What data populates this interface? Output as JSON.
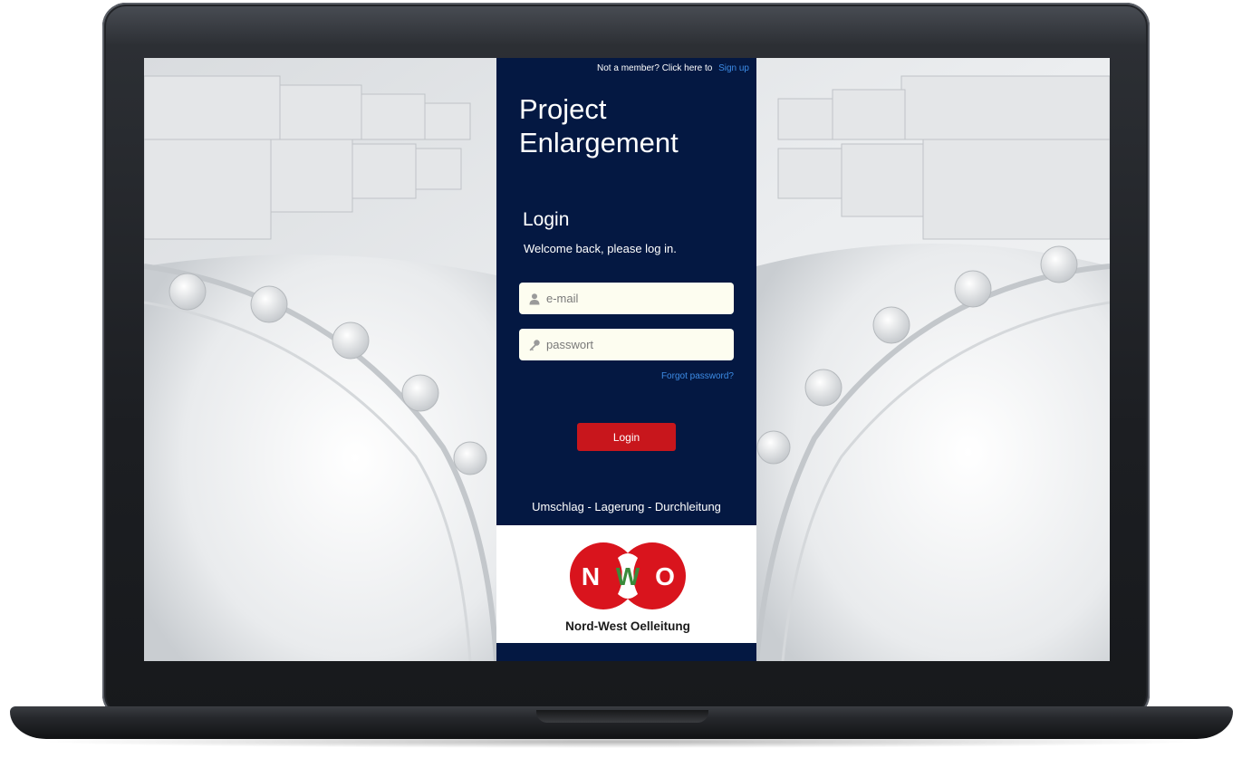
{
  "signup": {
    "prompt": "Not a member? Click here to",
    "link_label": "Sign up"
  },
  "header": {
    "title_line1": "Project",
    "title_line2": "Enlargement"
  },
  "login": {
    "heading": "Login",
    "welcome": "Welcome back, please log in.",
    "email_placeholder": "e-mail",
    "password_placeholder": "passwort",
    "forgot_label": "Forgot password?",
    "button_label": "Login"
  },
  "footer": {
    "tagline": "Umschlag - Lagerung - Durchleitung"
  },
  "logo": {
    "letters": [
      "N",
      "W",
      "O"
    ],
    "company": "Nord-West Oelleitung"
  },
  "colors": {
    "panel": "#041842",
    "accent_red": "#c8161c",
    "link_blue": "#3d8ce6",
    "logo_green": "#3a8a3a"
  }
}
